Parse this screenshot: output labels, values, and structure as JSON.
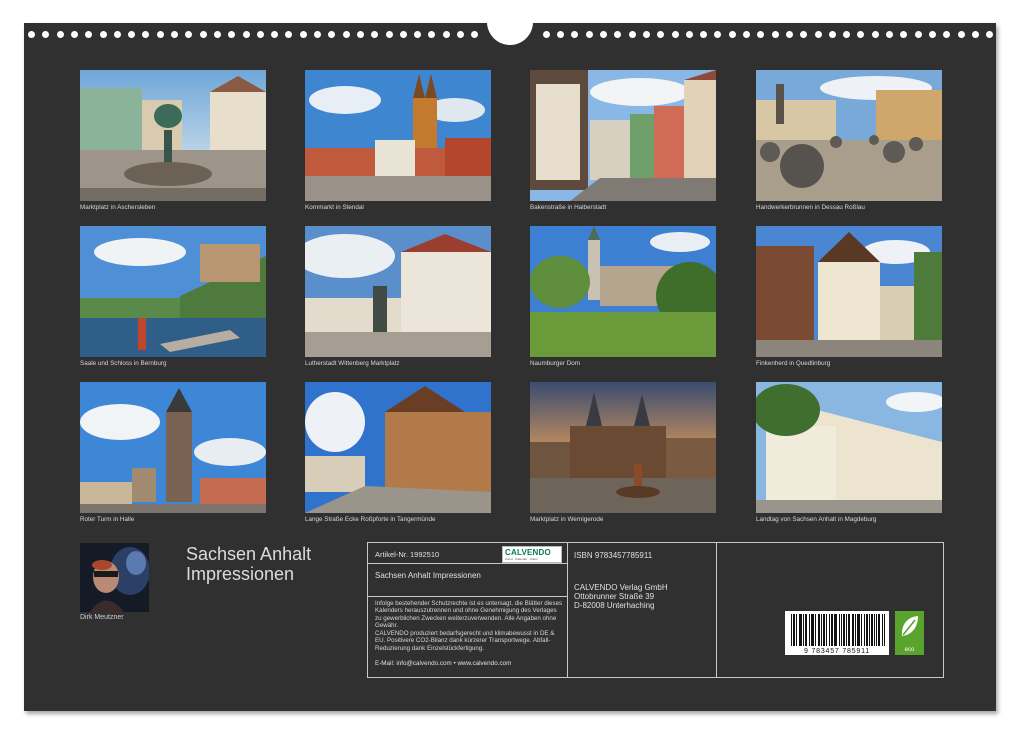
{
  "photos": [
    {
      "caption": "Marktplatz in Aschersleben"
    },
    {
      "caption": "Kornmarkt in Stendal"
    },
    {
      "caption": "Bakenstraße in Halberstadt"
    },
    {
      "caption": "Handwerkerbrunnen in Dessau Roßlau"
    },
    {
      "caption": "Saale und Schloss in Bernburg"
    },
    {
      "caption": "Lutherstadt Wittenberg Marktplatz"
    },
    {
      "caption": "Naumburger Dom"
    },
    {
      "caption": "Finkenherd in Quedlinburg"
    },
    {
      "caption": "Roter Turm in Halle"
    },
    {
      "caption": "Lange Straße Ecke Roßpforte in Tangermünde"
    },
    {
      "caption": "Marktplatz in Wernigerode"
    },
    {
      "caption": "Landtag von Sachsen Anhalt in Magdeburg"
    }
  ],
  "author": {
    "name": "Dirk Meutzner"
  },
  "calendar_title": {
    "line1": "Sachsen Anhalt",
    "line2": "Impressionen"
  },
  "info": {
    "article": "Artikel-Nr. 1992510",
    "brand": "CALVENDO",
    "brand_sub": "Kunst · Kalender · Kultur",
    "title": "Sachsen Anhalt Impressionen",
    "legal": "Infolge bestehender Schutzrechte ist es untersagt, die Blätter dieses Kalenders herauszutrennen und ohne Genehmigung des Verlages zu gewerblichen Zwecken weiterzuverwenden. Alle Angaben ohne Gewähr.",
    "climate": "CALVENDO produziert bedarfsgerecht und klimabewusst in DE & EU. Positivere CO2-Bilanz dank kürzerer Transportwege. Abfall-Reduzierung dank Einzelstückfertigung.",
    "email": "E-Mail: info@calvendo.com • www.calvendo.com",
    "isbn": "ISBN 9783457785911",
    "publisher": "CALVENDO Verlag GmbH",
    "street": "Ottobrunner Straße 39",
    "city": "D-82008 Unterhaching",
    "barcode_digits": "9 783457 785911",
    "eco_label": "eco"
  }
}
